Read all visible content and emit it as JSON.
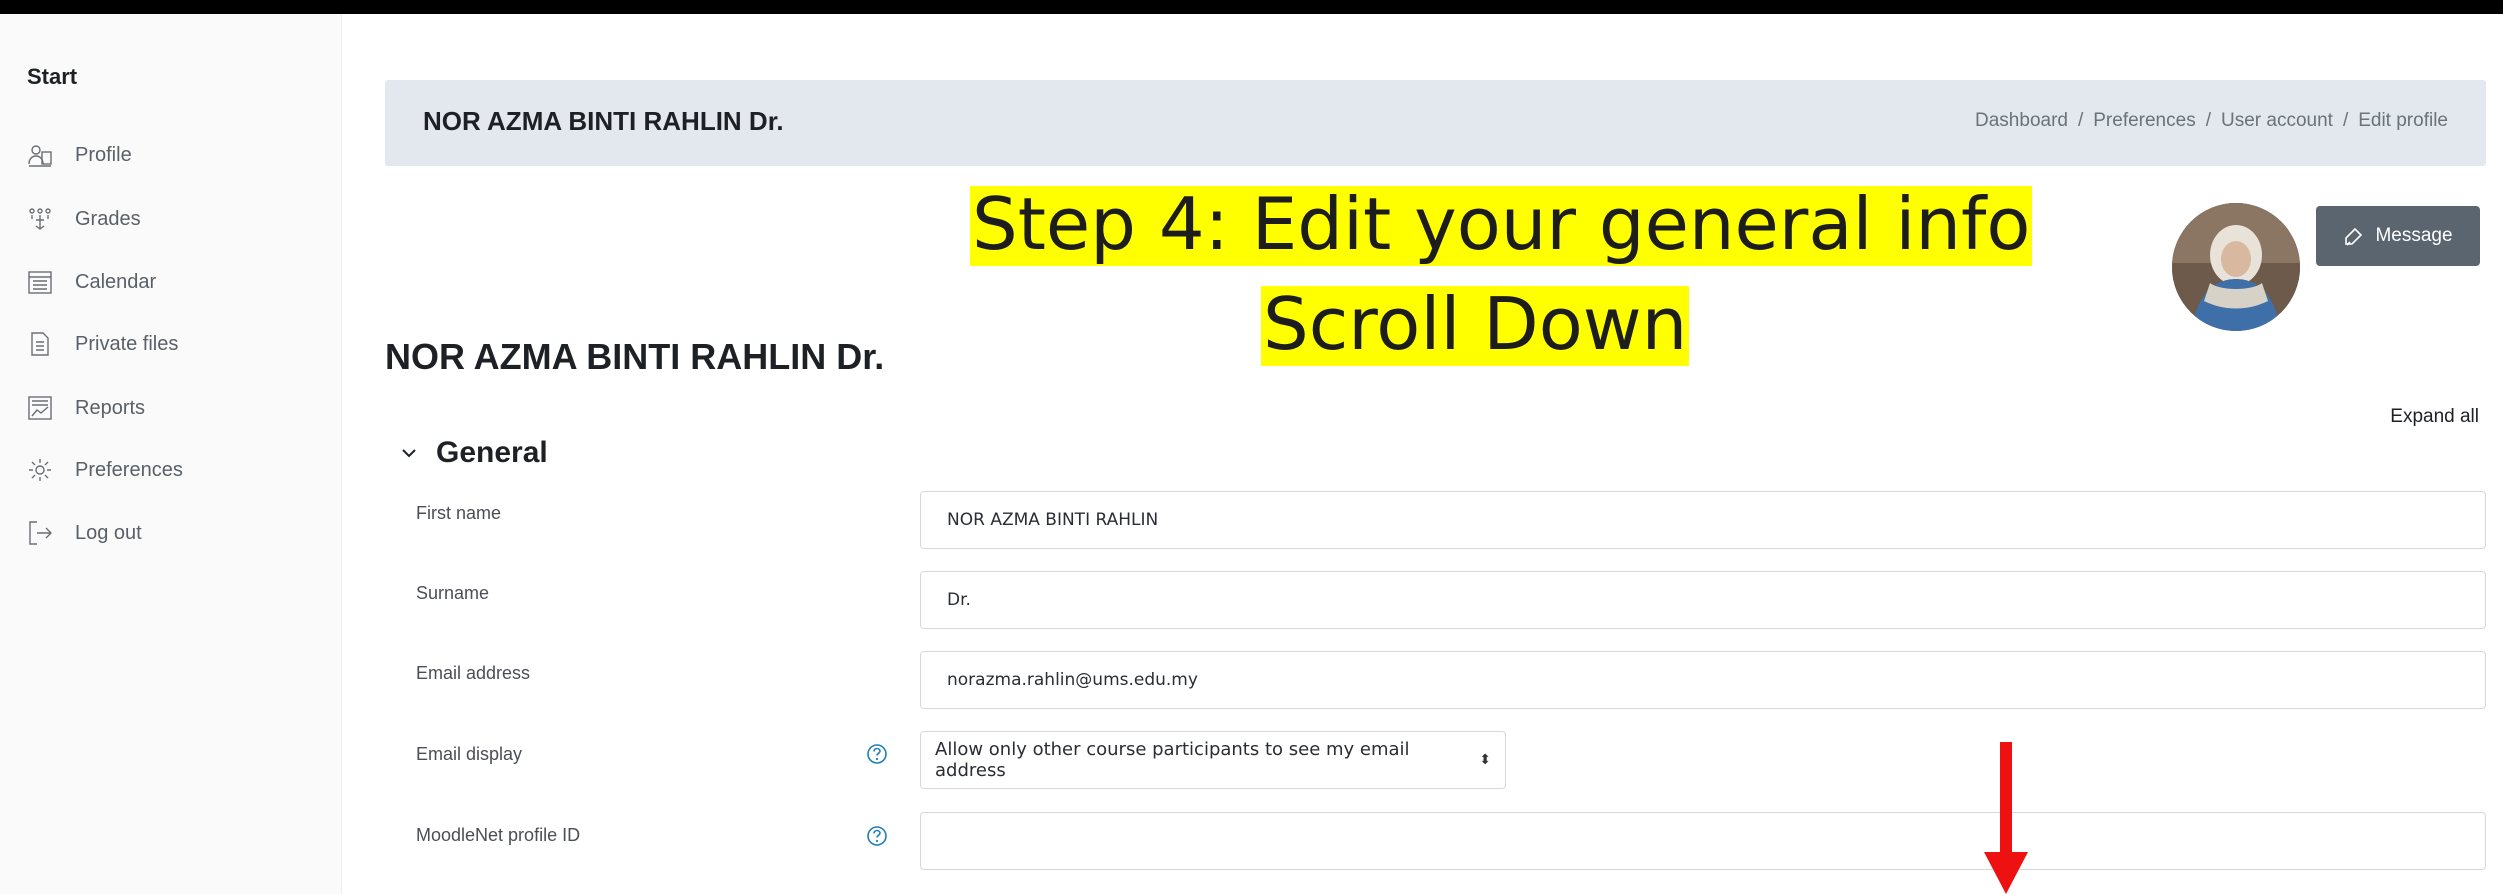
{
  "sidebar": {
    "heading": "Start",
    "items": [
      {
        "label": "Profile",
        "icon": "profile-icon"
      },
      {
        "label": "Grades",
        "icon": "grades-icon"
      },
      {
        "label": "Calendar",
        "icon": "calendar-icon"
      },
      {
        "label": "Private files",
        "icon": "private-files-icon"
      },
      {
        "label": "Reports",
        "icon": "reports-icon"
      },
      {
        "label": "Preferences",
        "icon": "gear-icon"
      },
      {
        "label": "Log out",
        "icon": "logout-icon"
      }
    ]
  },
  "header": {
    "name": "NOR AZMA BINTI RAHLIN Dr.",
    "breadcrumb": [
      "Dashboard",
      "Preferences",
      "User account",
      "Edit profile"
    ]
  },
  "annotation": {
    "line1": "Step 4: Edit your general info",
    "line2": "Scroll Down",
    "highlight_color": "#ffff00",
    "arrow_color": "#ee1111"
  },
  "profile": {
    "name": "NOR AZMA BINTI RAHLIN Dr.",
    "message_button": "Message"
  },
  "form": {
    "expand_all": "Expand all",
    "section_title": "General",
    "fields": {
      "first_name": {
        "label": "First name",
        "value": "NOR AZMA BINTI RAHLIN"
      },
      "surname": {
        "label": "Surname",
        "value": "Dr."
      },
      "email": {
        "label": "Email address",
        "value": "norazma.rahlin@ums.edu.my"
      },
      "email_display": {
        "label": "Email display",
        "value": "Allow only other course participants to see my email address"
      },
      "moodlenet": {
        "label": "MoodleNet profile ID",
        "value": ""
      }
    }
  },
  "colors": {
    "header_bg": "#e3e7ee",
    "button_bg": "#5a6570",
    "sidebar_bg": "#fafafa"
  }
}
